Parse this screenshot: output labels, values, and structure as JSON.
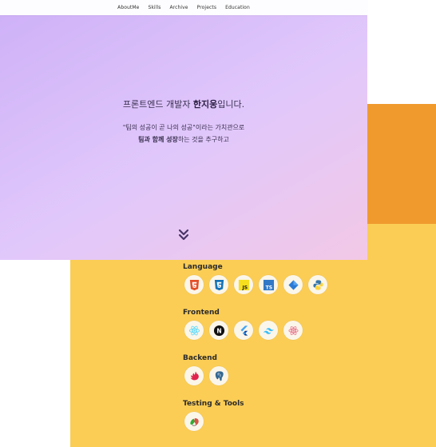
{
  "nav": {
    "items": [
      "AboutMe",
      "Skills",
      "Archive",
      "Projects",
      "Education"
    ]
  },
  "hero": {
    "headline_pre": "프론트엔드 개발자 ",
    "headline_name": "한지웅",
    "headline_post": "입니다.",
    "sub_line1": "\"팀의 성공이 곧 나의 성공\"이라는 가치관으로",
    "sub_bold": "팀과 함께 성장",
    "sub_line2_rest": "하는 것을 추구하고"
  },
  "skills": {
    "language": {
      "title": "Language",
      "icons": [
        "html5-icon",
        "css3-icon",
        "javascript-icon",
        "typescript-icon",
        "kotlin-icon",
        "python-icon"
      ],
      "js_text": "JS",
      "ts_text": "TS"
    },
    "frontend": {
      "title": "Frontend",
      "icons": [
        "react-icon",
        "nextjs-icon",
        "flutter-icon",
        "tailwind-icon",
        "recoil-icon"
      ],
      "next_text": "N"
    },
    "backend": {
      "title": "Backend",
      "icons": [
        "nestjs-icon",
        "postgresql-icon"
      ]
    },
    "testing": {
      "title": "Testing & Tools",
      "icons": [
        "playwright-icon"
      ]
    }
  },
  "colors": {
    "orange": "#f09a2e",
    "yellow": "#fbcd55",
    "hero_start": "#cdb0f7",
    "hero_end": "#f2c8e6"
  }
}
